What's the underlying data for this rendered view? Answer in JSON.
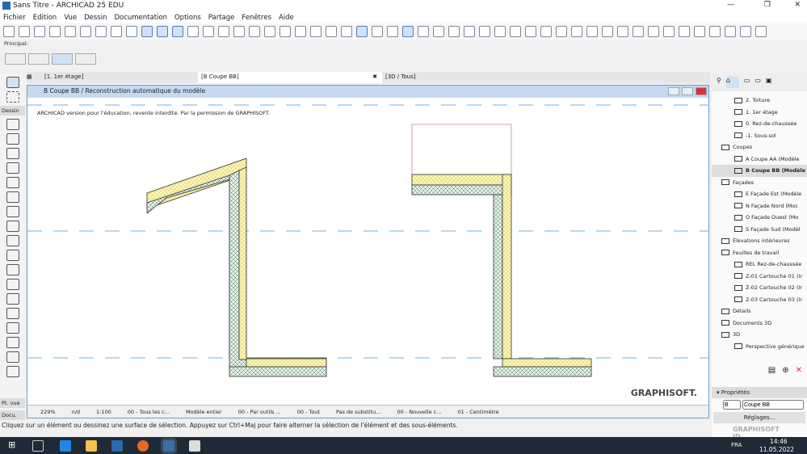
{
  "window": {
    "title": "Sans Titre - ARCHICAD 25 EDU"
  },
  "menu": [
    "Fichier",
    "Edition",
    "Vue",
    "Dessin",
    "Documentation",
    "Options",
    "Partage",
    "Fenêtres",
    "Aide"
  ],
  "toolbox": {
    "principal_label": "Principal:",
    "section_dessin": "Dessin",
    "section_ptvue": "Pt. vue",
    "section_docu": "Docu."
  },
  "tabs": [
    {
      "label": "[1. 1er étage]"
    },
    {
      "label": "[B Coupe BB]",
      "close": "✖"
    },
    {
      "label": "[3D / Tous]"
    }
  ],
  "view": {
    "title": "B Coupe BB / Reconstruction automatique du modèle",
    "notice": "ARCHICAD version pour l'éducation, revente interdite. Par la permission de GRAPHISOFT.",
    "watermark": "GRAPHISOFT."
  },
  "statusbar": [
    "229%",
    "n/d",
    "1:100",
    "00 - Tous les c...",
    "Modèle entier",
    "00 - Par outils ...",
    "00 - Tout",
    "Pas de substitu...",
    "00 - Nouvelle c...",
    "01 - Centimètre"
  ],
  "hint": "Cliquez sur un élément ou dessinez une surface de sélection. Appuyez sur Ctrl+Maj pour faire alterner la sélection de l'élément et des sous-éléments.",
  "navigator": [
    {
      "label": "2. Toiture",
      "indent": 2
    },
    {
      "label": "1. 1er étage",
      "indent": 2
    },
    {
      "label": "0. Rez-de-chaussée",
      "indent": 2
    },
    {
      "label": "-1. Sous-sol",
      "indent": 2
    },
    {
      "label": "Coupes",
      "indent": 1
    },
    {
      "label": "A Coupe AA (Modèle",
      "indent": 2
    },
    {
      "label": "B Coupe BB (Modèle",
      "indent": 2,
      "selected": true
    },
    {
      "label": "Façades",
      "indent": 1
    },
    {
      "label": "E Façade Est (Modèle",
      "indent": 2
    },
    {
      "label": "N Façade Nord (Moc",
      "indent": 2
    },
    {
      "label": "O Façade Ouest (Mo",
      "indent": 2
    },
    {
      "label": "S Façade Sud (Modèl",
      "indent": 2
    },
    {
      "label": "Élevations intérieures",
      "indent": 1
    },
    {
      "label": "Feuilles de travail",
      "indent": 1
    },
    {
      "label": "REL Rez-de-chaussée",
      "indent": 2
    },
    {
      "label": "Z-01 Cartouche 01 (Ir",
      "indent": 2
    },
    {
      "label": "Z-02 Cartouche 02 (Ir",
      "indent": 2
    },
    {
      "label": "Z-03 Cartouche 03 (Ir",
      "indent": 2
    },
    {
      "label": "Détails",
      "indent": 1
    },
    {
      "label": "Documents 3D",
      "indent": 1
    },
    {
      "label": "3D",
      "indent": 1
    },
    {
      "label": "Perspective générique",
      "indent": 2
    }
  ],
  "properties": {
    "header": "Propriétés",
    "id": "B",
    "name": "Coupe BB",
    "settings": "Réglages...",
    "graphisoft_id": "GRAPHISOFT ID"
  },
  "taskbar": {
    "lang": "FRA",
    "time": "14:46",
    "date": "11.05.2022"
  },
  "colors": {
    "insulation": "#fdf6b0",
    "structure": "#e6f2e6",
    "grid": "#6fb0e0",
    "accent": "#c4daf0"
  }
}
